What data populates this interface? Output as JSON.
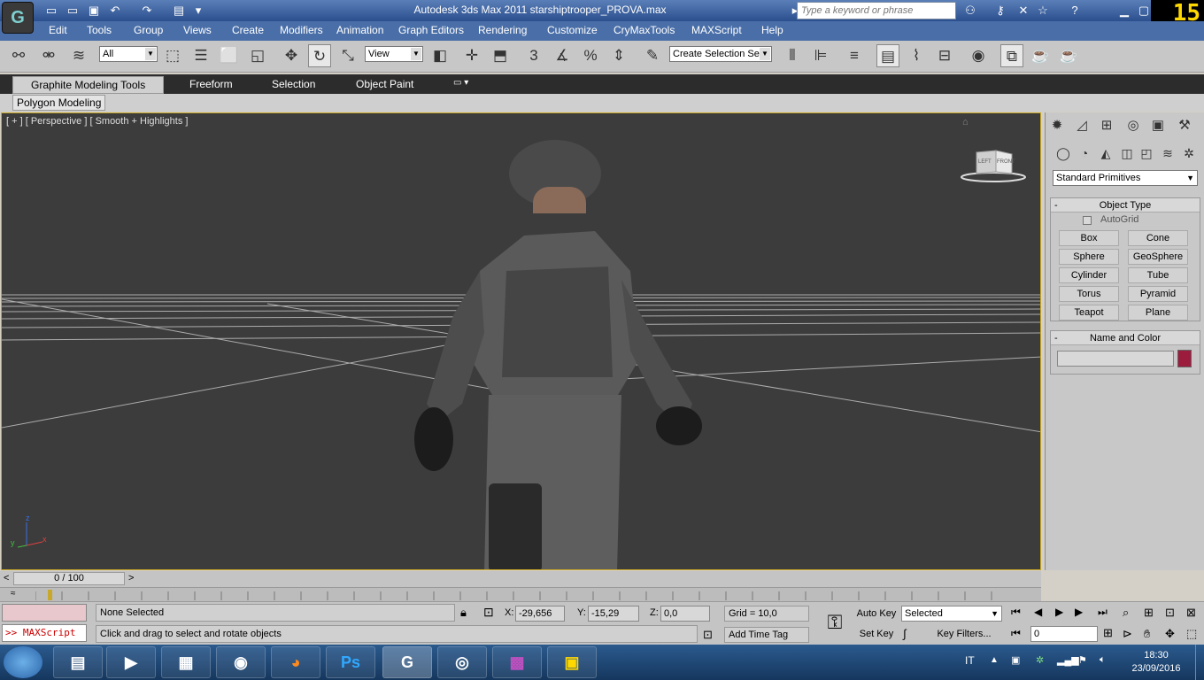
{
  "app": {
    "title": "Autodesk 3ds Max  2011    starshiptrooper_PROVA.max",
    "logo": "G",
    "search_placeholder": "Type a keyword or phrase",
    "fps": "15"
  },
  "menu": [
    "Edit",
    "Tools",
    "Group",
    "Views",
    "Create",
    "Modifiers",
    "Animation",
    "Graph Editors",
    "Rendering",
    "Customize",
    "CryMaxTools",
    "MAXScript",
    "Help"
  ],
  "toolbar": {
    "filter_value": "All",
    "ref_coord_value": "View",
    "snap_label": "3",
    "selection_set_value": "Create Selection Se"
  },
  "ribbon": {
    "tabs": [
      "Graphite Modeling Tools",
      "Freeform",
      "Selection",
      "Object Paint"
    ],
    "panel": "Polygon Modeling"
  },
  "viewport": {
    "label": "[ + ] [ Perspective ] [ Smooth + Highlights ]",
    "viewcube_left": "LEFT",
    "viewcube_front": "FRONT",
    "axis_x": "x",
    "axis_y": "y",
    "axis_z": "z"
  },
  "command_panel": {
    "category": "Standard Primitives",
    "object_type_title": "Object Type",
    "autogrid": "AutoGrid",
    "primitives": [
      "Box",
      "Cone",
      "Sphere",
      "GeoSphere",
      "Cylinder",
      "Tube",
      "Torus",
      "Pyramid",
      "Teapot",
      "Plane"
    ],
    "name_color_title": "Name and Color",
    "color": "#9b1c3c"
  },
  "timeline": {
    "frame": "0 / 100",
    "prev": "<",
    "next": ">"
  },
  "status": {
    "maxscript": ">> MAXScript",
    "selection": "None Selected",
    "prompt": "Click and drag to select and rotate objects",
    "x_label": "X:",
    "x": "-29,656",
    "y_label": "Y:",
    "y": "-15,29",
    "z_label": "Z:",
    "z": "0,0",
    "grid": "Grid = 10,0",
    "add_time_tag": "Add Time Tag",
    "auto_key": "Auto Key",
    "set_key": "Set Key",
    "key_mode": "Selected",
    "key_filters": "Key Filters...",
    "current_frame": "0"
  },
  "taskbar": {
    "apps": [
      "Explorer",
      "Media",
      "Office",
      "Disc",
      "Firefox",
      "Ps",
      "3ds Max",
      "Blender",
      "WinRAR",
      "Settings"
    ],
    "language": "IT",
    "time": "18:30",
    "date": "23/09/2016"
  }
}
